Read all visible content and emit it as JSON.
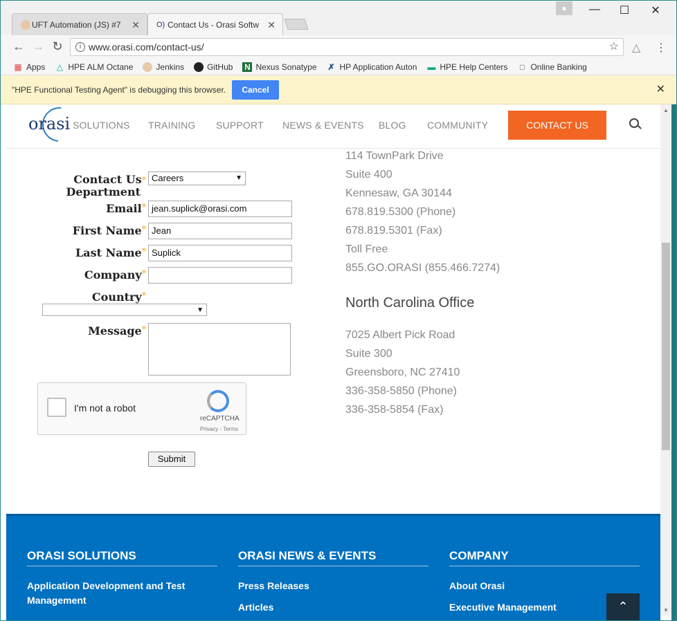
{
  "browser": {
    "tabs": [
      {
        "title": "UFT Automation (JS) #7"
      },
      {
        "title": "Contact Us - Orasi Softw"
      }
    ],
    "url": "www.orasi.com/contact-us/",
    "bookmarks": [
      {
        "label": "Apps",
        "icon": "apps-grid-icon"
      },
      {
        "label": "HPE ALM Octane",
        "icon": "octane-icon"
      },
      {
        "label": "Jenkins",
        "icon": "jenkins-icon"
      },
      {
        "label": "GitHub",
        "icon": "github-icon"
      },
      {
        "label": "Nexus Sonatype",
        "icon": "nexus-icon"
      },
      {
        "label": "HP Application Auton",
        "icon": "hp-tool-icon"
      },
      {
        "label": "HPE Help Centers",
        "icon": "hpe-icon"
      },
      {
        "label": "Online Banking",
        "icon": "page-icon"
      }
    ],
    "debug_message": "\"HPE Functional Testing Agent\" is debugging this browser.",
    "debug_cancel": "Cancel"
  },
  "site": {
    "nav": [
      "SOLUTIONS",
      "TRAINING",
      "SUPPORT",
      "NEWS & EVENTS",
      "BLOG",
      "COMMUNITY"
    ],
    "contact_button": "CONTACT US",
    "logo_text": "orasi"
  },
  "form": {
    "department_label": "Contact Us Department",
    "department_line1": "Contact Us",
    "department_line2": "Department",
    "department_value": "Careers",
    "email_label": "Email",
    "email_value": "jean.suplick@orasi.com",
    "first_name_label": "First Name",
    "first_name_value": "Jean",
    "last_name_label": "Last Name",
    "last_name_value": "Suplick",
    "company_label": "Company",
    "company_value": "",
    "country_label": "Country",
    "country_value": "",
    "message_label": "Message",
    "required_mark": "*",
    "captcha_label": "I'm not a robot",
    "captcha_brand": "reCAPTCHA",
    "captcha_links": "Privacy - Terms",
    "submit_label": "Submit"
  },
  "offices": {
    "georgia_lines": [
      "114 TownPark Drive",
      "Suite 400",
      "Kennesaw, GA 30144",
      "678.819.5300 (Phone)",
      "678.819.5301 (Fax)",
      "Toll Free",
      "855.GO.ORASI (855.466.7274)"
    ],
    "nc_title": "North Carolina Office",
    "nc_lines": [
      "7025 Albert Pick Road",
      "Suite 300",
      "Greensboro, NC 27410",
      "336-358-5850 (Phone)",
      "336-358-5854 (Fax)"
    ]
  },
  "footer": {
    "col1_title": "ORASI SOLUTIONS",
    "col1_links": [
      "Application Development and Test Management"
    ],
    "col2_title": "ORASI NEWS & EVENTS",
    "col2_links": [
      "Press Releases",
      "Articles"
    ],
    "col3_title": "COMPANY",
    "col3_links": [
      "About Orasi",
      "Executive Management"
    ]
  },
  "colors": {
    "accent_orange": "#f26522",
    "footer_blue": "#0070c0",
    "debug_bar": "#fdf4cc",
    "chrome_blue_button": "#4285f4"
  }
}
